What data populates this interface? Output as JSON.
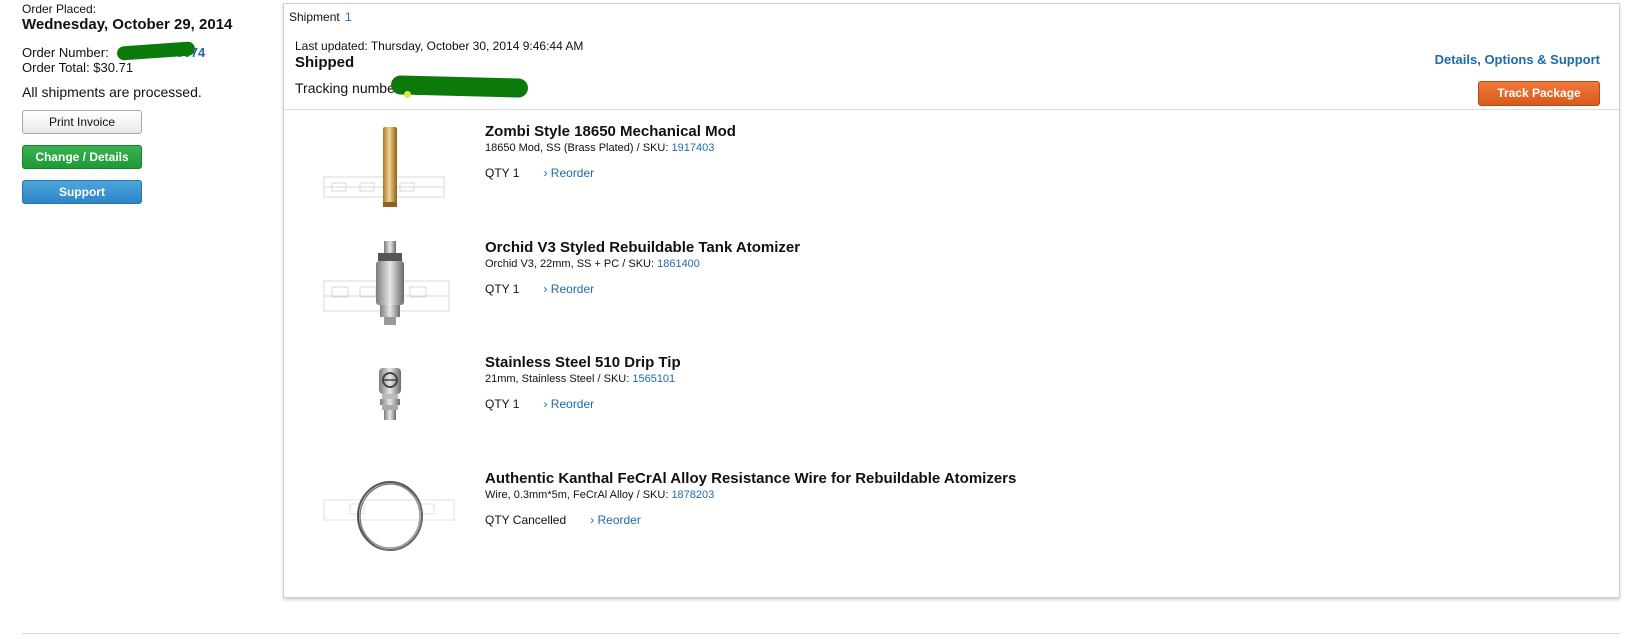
{
  "order": {
    "placed_label": "Order Placed:",
    "placed_date": "Wednesday, October 29, 2014",
    "number_label": "Order Number:",
    "number_visible_suffix": "0074",
    "total": "Order Total: $30.71",
    "status_note": "All shipments are processed."
  },
  "buttons": {
    "print": "Print Invoice",
    "change": "Change / Details",
    "support": "Support"
  },
  "shipment": {
    "title_label": "Shipment",
    "title_num": "1",
    "last_updated": "Last updated: Thursday, October 30, 2014 9:46:44 AM",
    "status": "Shipped",
    "tracking_label": "Tracking number:",
    "details_link": "Details, Options & Support",
    "track_button": "Track Package"
  },
  "items": [
    {
      "title": "Zombi Style 18650 Mechanical Mod",
      "sub": "18650 Mod, SS (Brass Plated) / SKU: ",
      "sku": "1917403",
      "qty": "QTY 1",
      "reorder": "› Reorder",
      "icon": "mod-tube-icon"
    },
    {
      "title": "Orchid V3 Styled Rebuildable Tank Atomizer",
      "sub": "Orchid V3, 22mm, SS + PC / SKU: ",
      "sku": "1861400",
      "qty": "QTY 1",
      "reorder": "› Reorder",
      "icon": "atomizer-icon"
    },
    {
      "title": "Stainless Steel 510 Drip Tip",
      "sub": "21mm, Stainless Steel / SKU: ",
      "sku": "1565101",
      "qty": "QTY 1",
      "reorder": "› Reorder",
      "icon": "drip-tip-icon"
    },
    {
      "title": "Authentic Kanthal FeCrAl Alloy Resistance Wire for Rebuildable Atomizers",
      "sub": "Wire, 0.3mm*5m, FeCrAl Alloy / SKU: ",
      "sku": "1878203",
      "qty": "QTY Cancelled",
      "reorder": "› Reorder",
      "icon": "wire-coil-icon"
    }
  ],
  "colors": {
    "link": "#1f6aa8",
    "change_button": "#1e9a37",
    "support_button": "#2d86c6",
    "track_button": "#d85a1c",
    "redaction": "#0b7a0b"
  }
}
